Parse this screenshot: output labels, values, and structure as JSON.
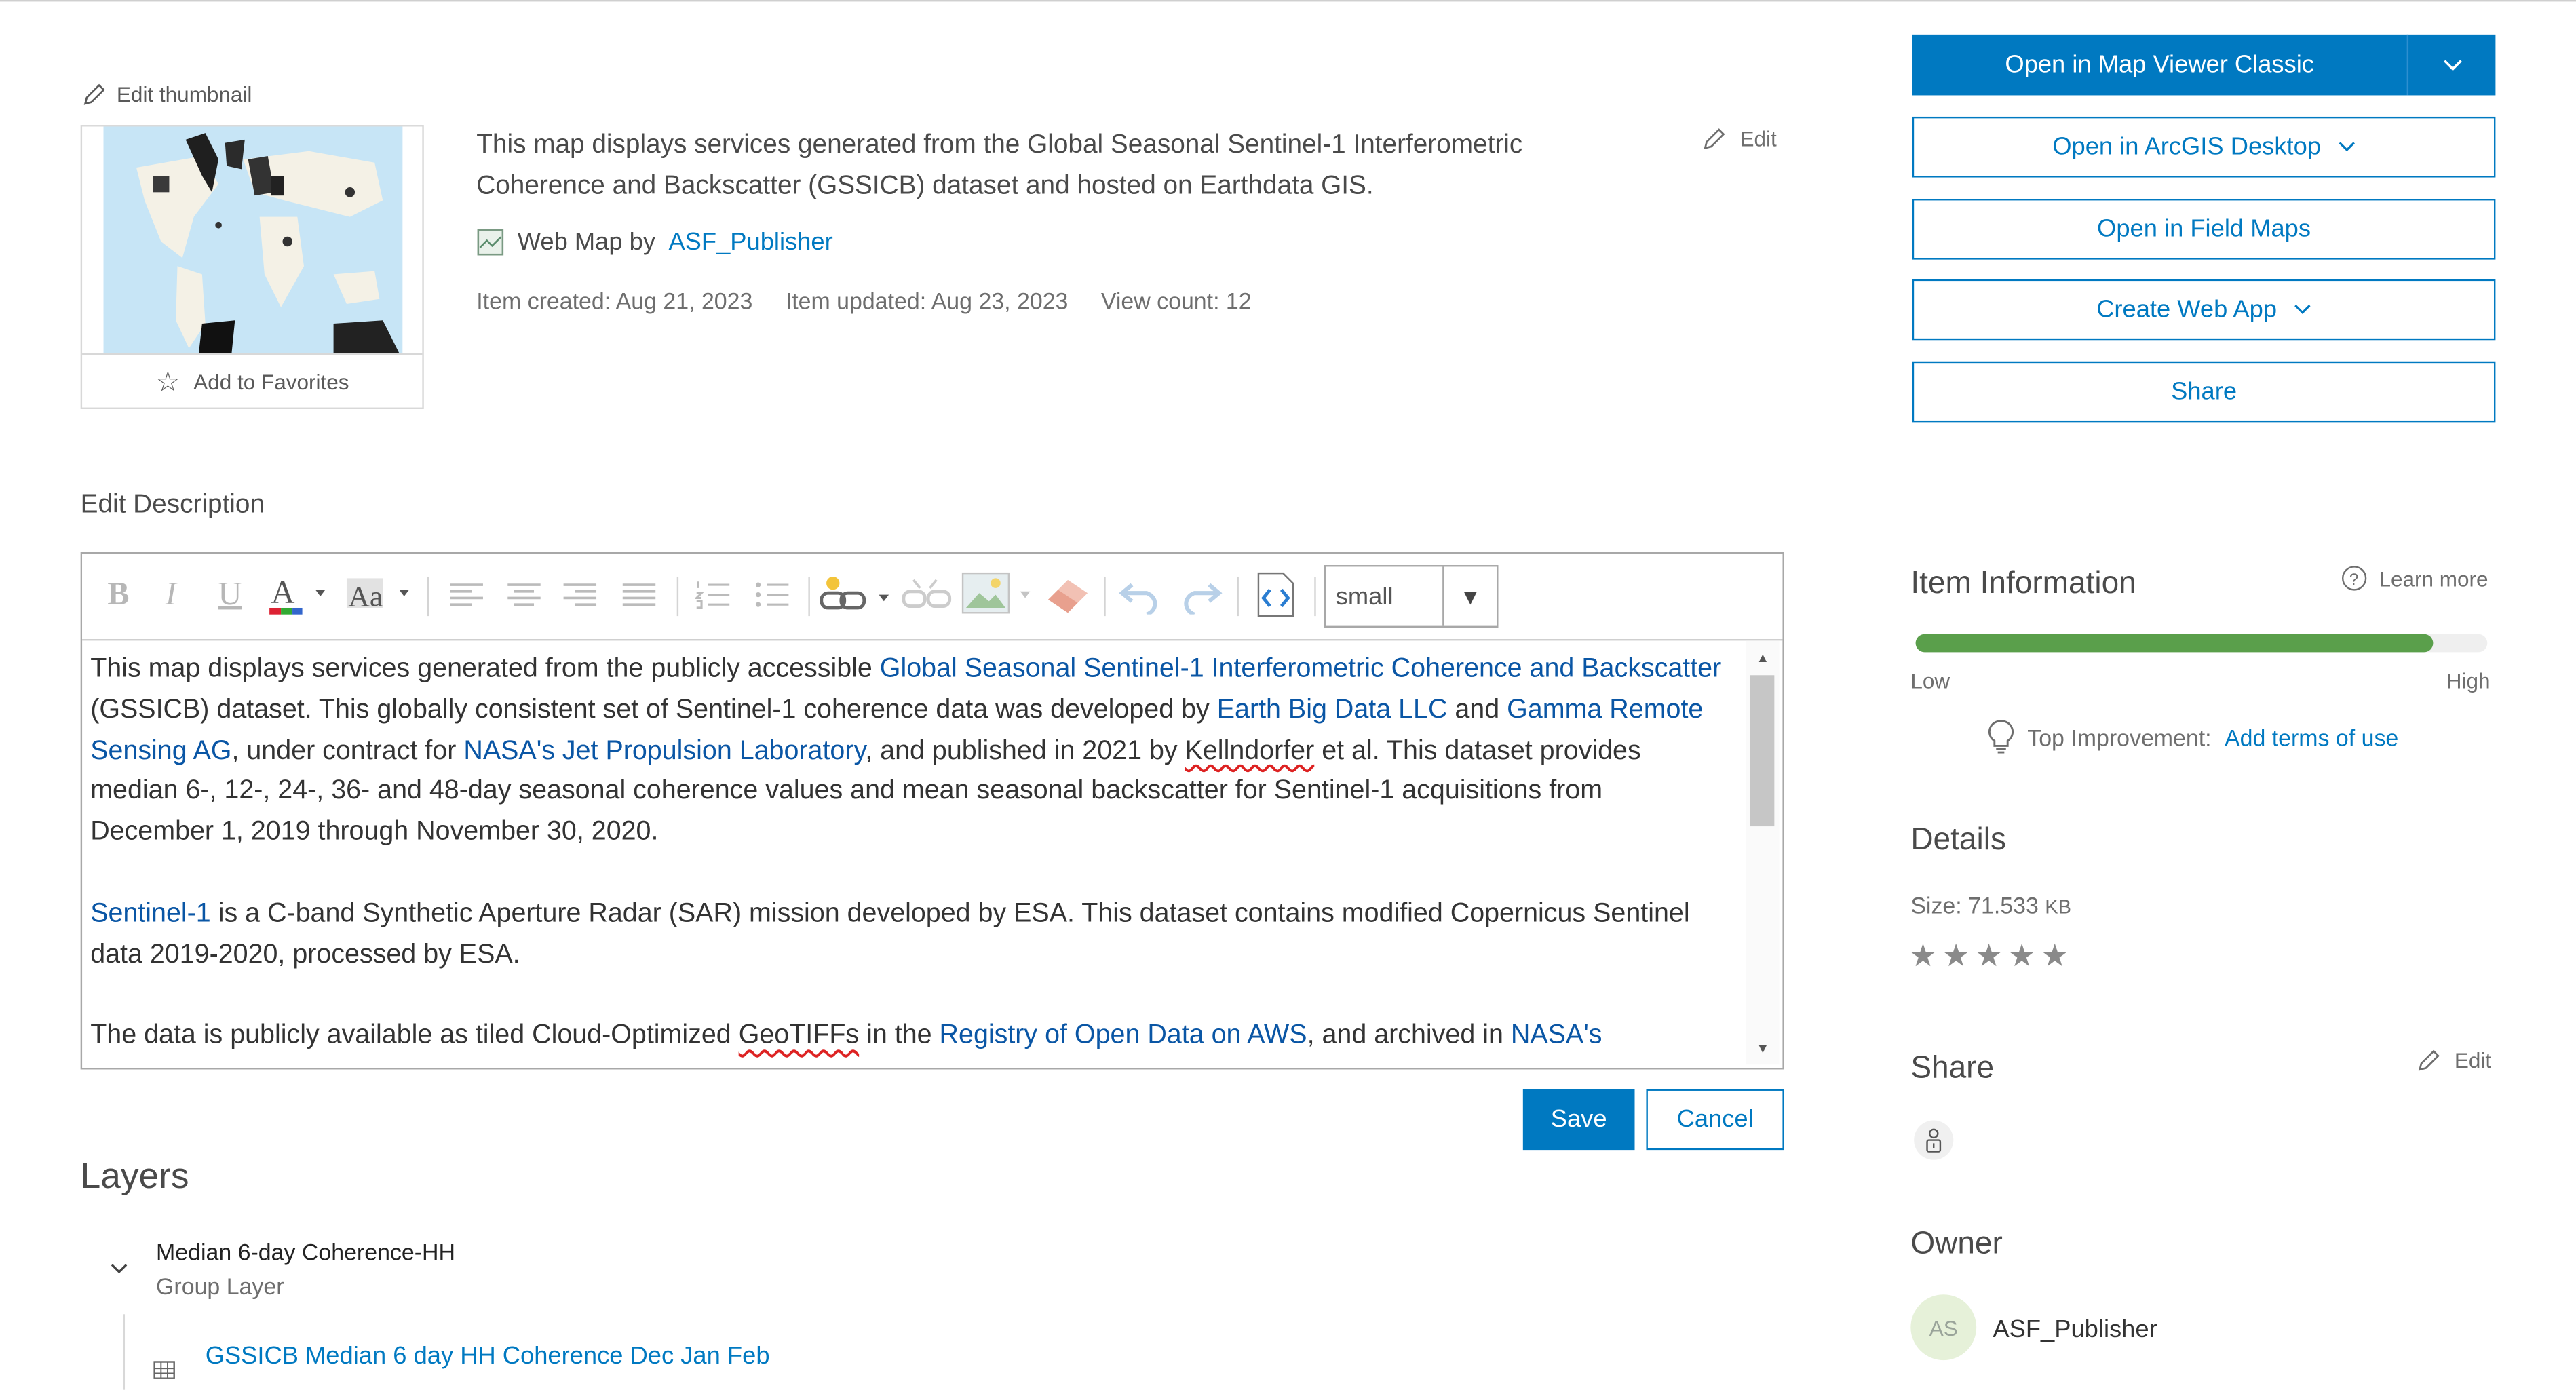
{
  "thumbnail": {
    "edit_label": "Edit thumbnail",
    "favorite_label": "Add to Favorites"
  },
  "summary": {
    "text": "This map displays services generated from the Global Seasonal Sentinel-1 Interferometric Coherence and Backscatter (GSSICB) dataset and hosted on Earthdata GIS.",
    "edit_label": "Edit",
    "type_label": "Web Map by",
    "owner_link": "ASF_Publisher",
    "created": "Item created: Aug 21, 2023",
    "updated": "Item updated: Aug 23, 2023",
    "views": "View count: 12"
  },
  "actions": {
    "primary": "Open in Map Viewer Classic",
    "desktop": "Open in ArcGIS Desktop",
    "field_maps": "Open in Field Maps",
    "web_app": "Create Web App",
    "share": "Share"
  },
  "editor": {
    "label": "Edit Description",
    "font_size": "small",
    "p1": {
      "t1": "This map displays services generated from the publicly accessible ",
      "l1": "Global Seasonal Sentinel-1 Interferometric Coherence and Backscatter",
      "t2": " (GSSICB) dataset. This globally consistent set of Sentinel-1 coherence data was developed by ",
      "l2": "Earth Big Data LLC",
      "t3": " and ",
      "l3": "Gamma Remote Sensing AG",
      "t4": ", under contract for ",
      "l4": "NASA's Jet Propulsion Laboratory",
      "t5": ", and published in 2021 by ",
      "sq1": "Kellndorfer",
      "t6": " et al. This dataset provides median 6-, 12-, 24-, 36- and 48-day seasonal coherence values and mean seasonal backscatter for Sentinel-1 acquisitions from December 1, 2019 through November 30, 2020."
    },
    "p2": {
      "l1": "Sentinel-1",
      "t1": " is a C-band Synthetic Aperture Radar (SAR) mission developed by ESA. This dataset contains modified Copernicus Sentinel data 2019-2020, processed by ESA."
    },
    "p3": {
      "t1": "The data is publicly available as tiled Cloud-Optimized ",
      "sq1": "GeoTIFFs",
      "t2": " in the ",
      "l1": "Registry of Open Data on AWS",
      "t3": ", and archived in ",
      "l2": "NASA's"
    },
    "save": "Save",
    "cancel": "Cancel"
  },
  "layers": {
    "heading": "Layers",
    "group_title": "Median 6-day Coherence-HH",
    "group_type": "Group Layer",
    "sublayer": "GSSICB Median 6 day HH Coherence Dec Jan Feb"
  },
  "item_info": {
    "heading": "Item Information",
    "learn_more": "Learn more",
    "score_fraction": 0.905,
    "low": "Low",
    "high": "High",
    "top_improvement_label": "Top Improvement:",
    "top_improvement_link": "Add terms of use"
  },
  "details": {
    "heading": "Details",
    "size_label": "Size: 71.533",
    "size_unit": "KB",
    "rating": 0
  },
  "share": {
    "heading": "Share",
    "edit_label": "Edit"
  },
  "owner": {
    "heading": "Owner",
    "initials": "AS",
    "name": "ASF_Publisher"
  },
  "colors": {
    "accent": "#0079c1",
    "score_bar": "#5a9f4b",
    "link_text": "#0a56a5"
  }
}
